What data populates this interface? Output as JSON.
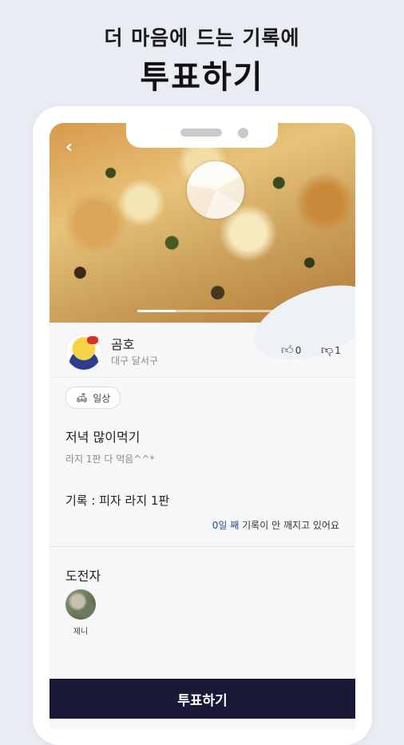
{
  "promo": {
    "subtitle": "더 마음에 드는 기록에",
    "title": "투표하기"
  },
  "post": {
    "author": {
      "name": "곰호",
      "location": "대구 달서구"
    },
    "likes": "0",
    "dislikes": "1",
    "category": "일상",
    "title": "저녁 많이먹기",
    "description": "라지 1판 다 먹음^^*",
    "record": "기록 : 피자 라지 1판",
    "record_status": {
      "days": "0일 째",
      "text": " 기록이 안 깨지고 있어요"
    }
  },
  "challengers": {
    "heading": "도전자",
    "items": [
      {
        "name": "제니"
      }
    ]
  },
  "vote_button": "투표하기",
  "icons": {
    "back": "chevron-left-icon",
    "like": "thumbs-up-icon",
    "dislike": "thumbs-down-icon",
    "category": "sofa-icon"
  },
  "colors": {
    "accent": "#191a38",
    "days_highlight": "#2a4fa0"
  }
}
